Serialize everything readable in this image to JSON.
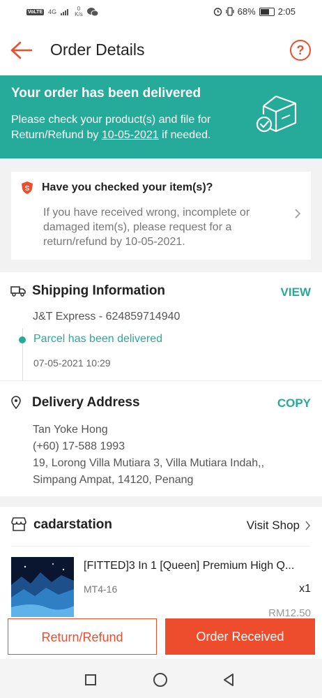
{
  "status_bar": {
    "network": "VoLTE",
    "signal": "4G",
    "speed_value": "0",
    "speed_unit": "K/s",
    "battery": "68%",
    "time": "2:05"
  },
  "header": {
    "title": "Order Details",
    "help_glyph": "?"
  },
  "banner": {
    "title": "Your order has been delivered",
    "body_prefix": "Please check your product(s) and file for Return/Refund by ",
    "date": "10-05-2021",
    "body_suffix": " if needed."
  },
  "check_card": {
    "title": "Have you checked your item(s)?",
    "body": "If you have received wrong, incomplete or damaged item(s), please request for a return/refund by 10-05-2021."
  },
  "shipping": {
    "title": "Shipping Information",
    "view_label": "VIEW",
    "courier": "J&T Express - 624859714940",
    "status": "Parcel has been delivered",
    "timestamp": "07-05-2021 10:29"
  },
  "delivery": {
    "title": "Delivery Address",
    "copy_label": "COPY",
    "name": "Tan Yoke Hong",
    "phone": "(+60) 17-588 1993",
    "line1": "19, Lorong Villa Mutiara 3, Villa Mutiara Indah,,",
    "line2": "Simpang Ampat, 14120, Penang"
  },
  "shop": {
    "name": "cadarstation",
    "visit_label": "Visit Shop",
    "product_name": "[FITTED]3 In 1 [Queen] Premium High Q...",
    "variant": "MT4-16",
    "quantity": "x1",
    "price_peek": "RM12.50"
  },
  "actions": {
    "return_label": "Return/Refund",
    "received_label": "Order Received"
  },
  "colors": {
    "brand": "#ee4d2d",
    "teal": "#26aa99"
  }
}
